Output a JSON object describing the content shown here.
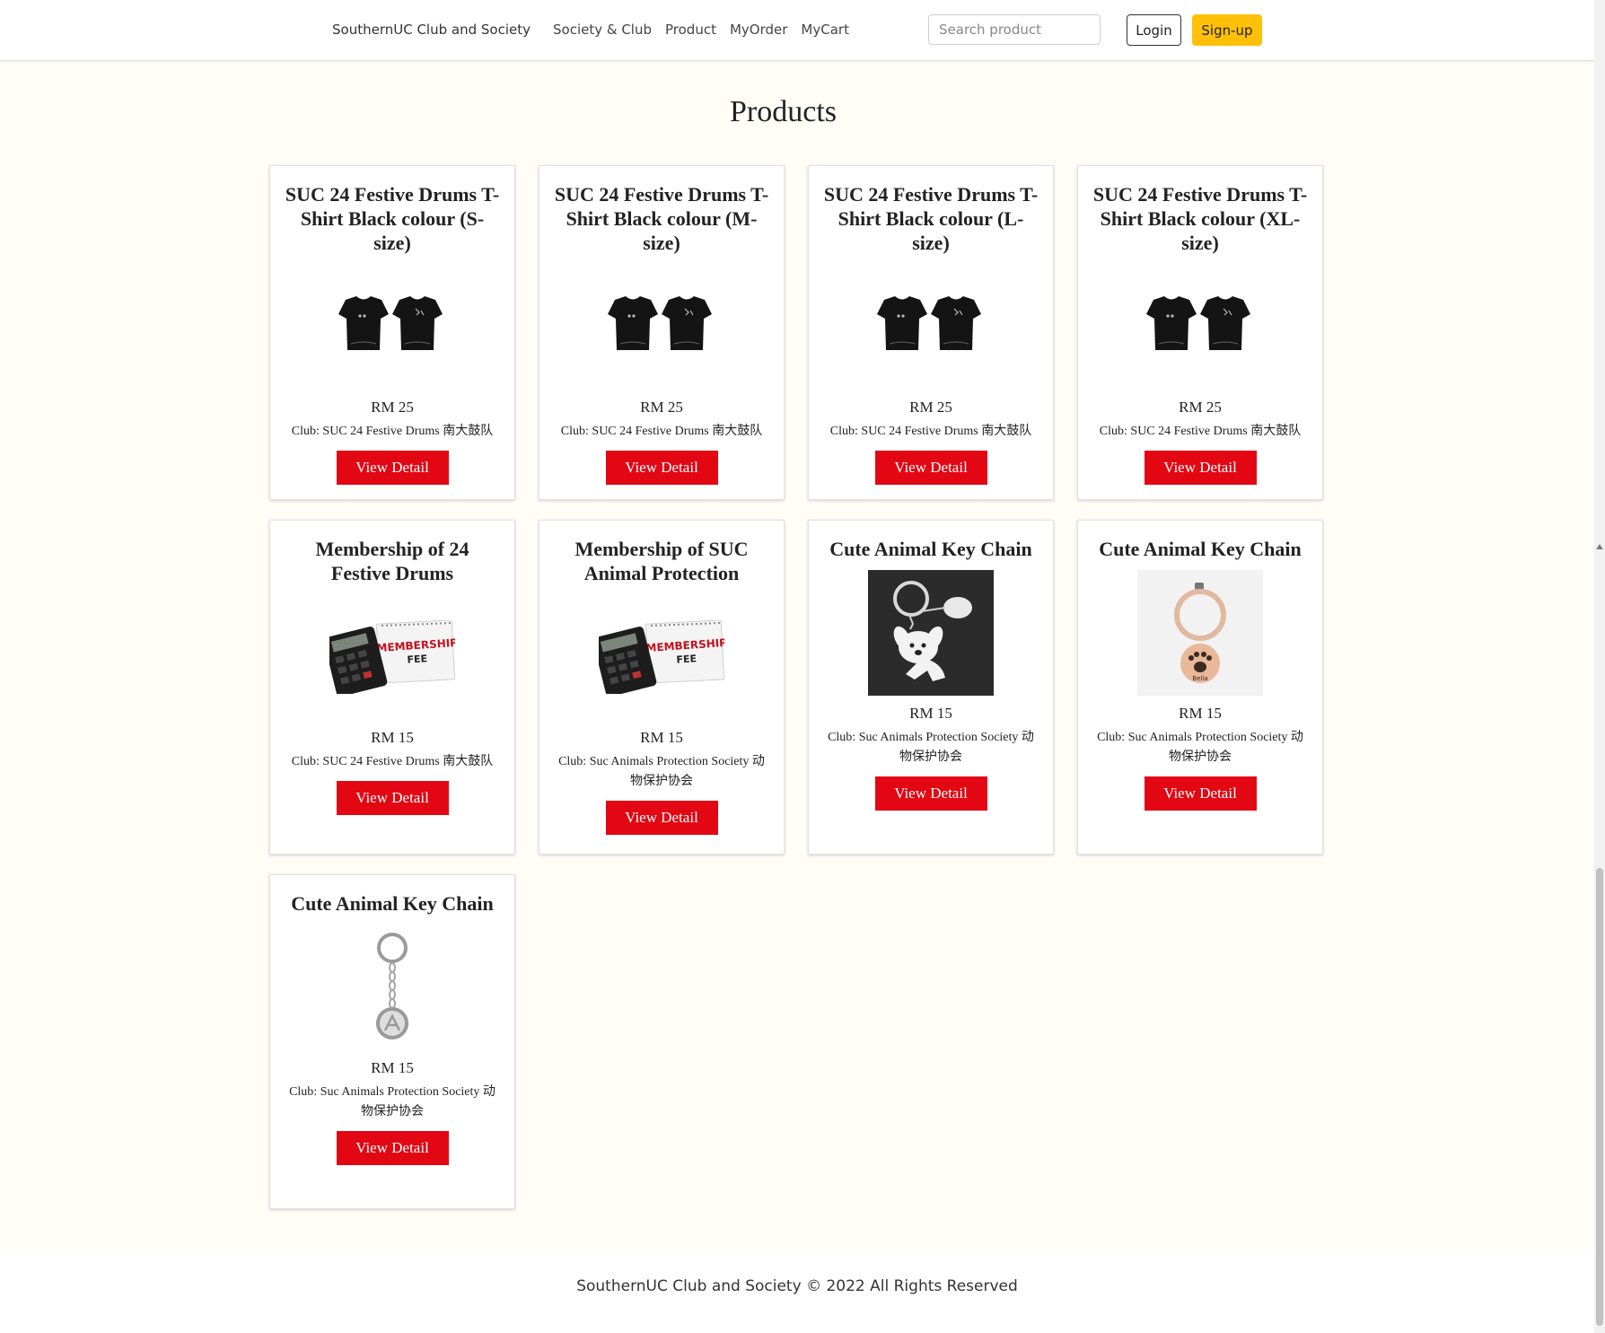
{
  "navbar": {
    "brand": "SouthernUC Club and Society",
    "links": [
      "Society & Club",
      "Product",
      "MyOrder",
      "MyCart"
    ],
    "search_placeholder": "Search product",
    "login_label": "Login",
    "signup_label": "Sign-up"
  },
  "page": {
    "title": "Products"
  },
  "products": [
    {
      "name": "SUC 24 Festive Drums T-Shirt Black colour (S-size)",
      "price": "RM 25",
      "club": "Club: SUC 24 Festive Drums 南大鼓队",
      "button": "View Detail",
      "image": "tshirt"
    },
    {
      "name": "SUC 24 Festive Drums T-Shirt Black colour (M-size)",
      "price": "RM 25",
      "club": "Club: SUC 24 Festive Drums 南大鼓队",
      "button": "View Detail",
      "image": "tshirt"
    },
    {
      "name": "SUC 24 Festive Drums T-Shirt Black colour (L-size)",
      "price": "RM 25",
      "club": "Club: SUC 24 Festive Drums 南大鼓队",
      "button": "View Detail",
      "image": "tshirt"
    },
    {
      "name": "SUC 24 Festive Drums T-Shirt Black colour (XL-size)",
      "price": "RM 25",
      "club": "Club: SUC 24 Festive Drums 南大鼓队",
      "button": "View Detail",
      "image": "tshirt"
    },
    {
      "name": "Membership of 24 Festive Drums",
      "price": "RM 15",
      "club": "Club: SUC 24 Festive Drums 南大鼓队",
      "button": "View Detail",
      "image": "membership",
      "image_text": [
        "MEMBERSHIP",
        "FEE"
      ]
    },
    {
      "name": "Membership of SUC Animal Protection",
      "price": "RM 15",
      "club": "Club: Suc Animals Protection Society 动物保护协会",
      "button": "View Detail",
      "image": "membership",
      "image_text": [
        "MEMBERSHIP",
        "FEE"
      ]
    },
    {
      "name": "Cute Animal Key Chain",
      "price": "RM 15",
      "club": "Club: Suc Animals Protection Society 动物保护协会",
      "button": "View Detail",
      "image": "keychain-dog"
    },
    {
      "name": "Cute Animal Key Chain",
      "price": "RM 15",
      "club": "Club: Suc Animals Protection Society 动物保护协会",
      "button": "View Detail",
      "image": "keychain-paw",
      "image_text": [
        "Bella"
      ]
    },
    {
      "name": "Cute Animal Key Chain",
      "price": "RM 15",
      "club": "Club: Suc Animals Protection Society 动物保护协会",
      "button": "View Detail",
      "image": "keychain-silver"
    }
  ],
  "footer": {
    "text": "SouthernUC Club and Society © 2022 All Rights Reserved"
  },
  "colors": {
    "accent": "#e30613",
    "signup": "#ffc107",
    "background": "#fffdf6"
  }
}
